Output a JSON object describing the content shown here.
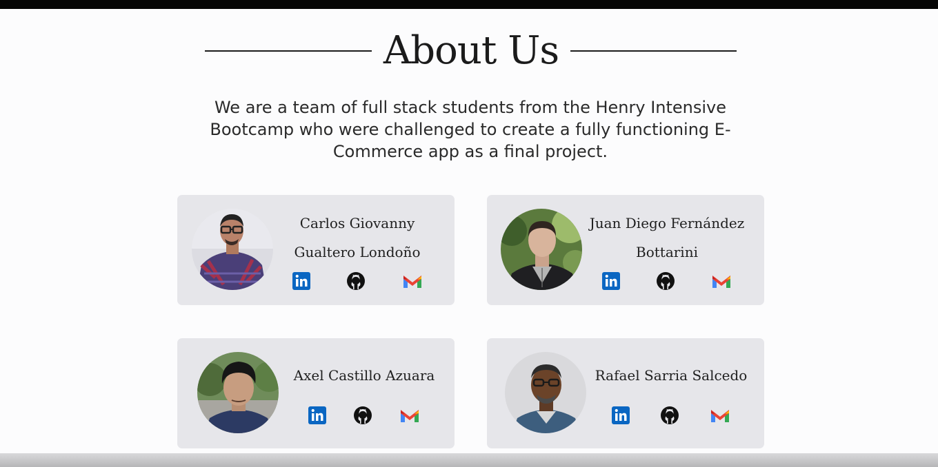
{
  "page": {
    "title": "About Us",
    "intro": "We are a team of full stack students from the Henry Intensive Bootcamp who were challenged to create a fully functioning E-Commerce app as a final project."
  },
  "team": [
    {
      "name_line1": "Carlos Giovanny",
      "name_line2": "Gualtero Londoño"
    },
    {
      "name_line1": "Juan Diego Fernández",
      "name_line2": "Bottarini"
    },
    {
      "name_line1": "Axel Castillo Azuara"
    },
    {
      "name_line1": "Rafael Sarria Salcedo"
    }
  ],
  "icons": {
    "linkedin": "linkedin-icon",
    "github": "github-icon",
    "gmail": "gmail-icon"
  },
  "colors": {
    "background": "#fcfcfd",
    "card": "#e6e6ea",
    "text": "#1b1b1b",
    "linkedin": "#0a66c2"
  }
}
